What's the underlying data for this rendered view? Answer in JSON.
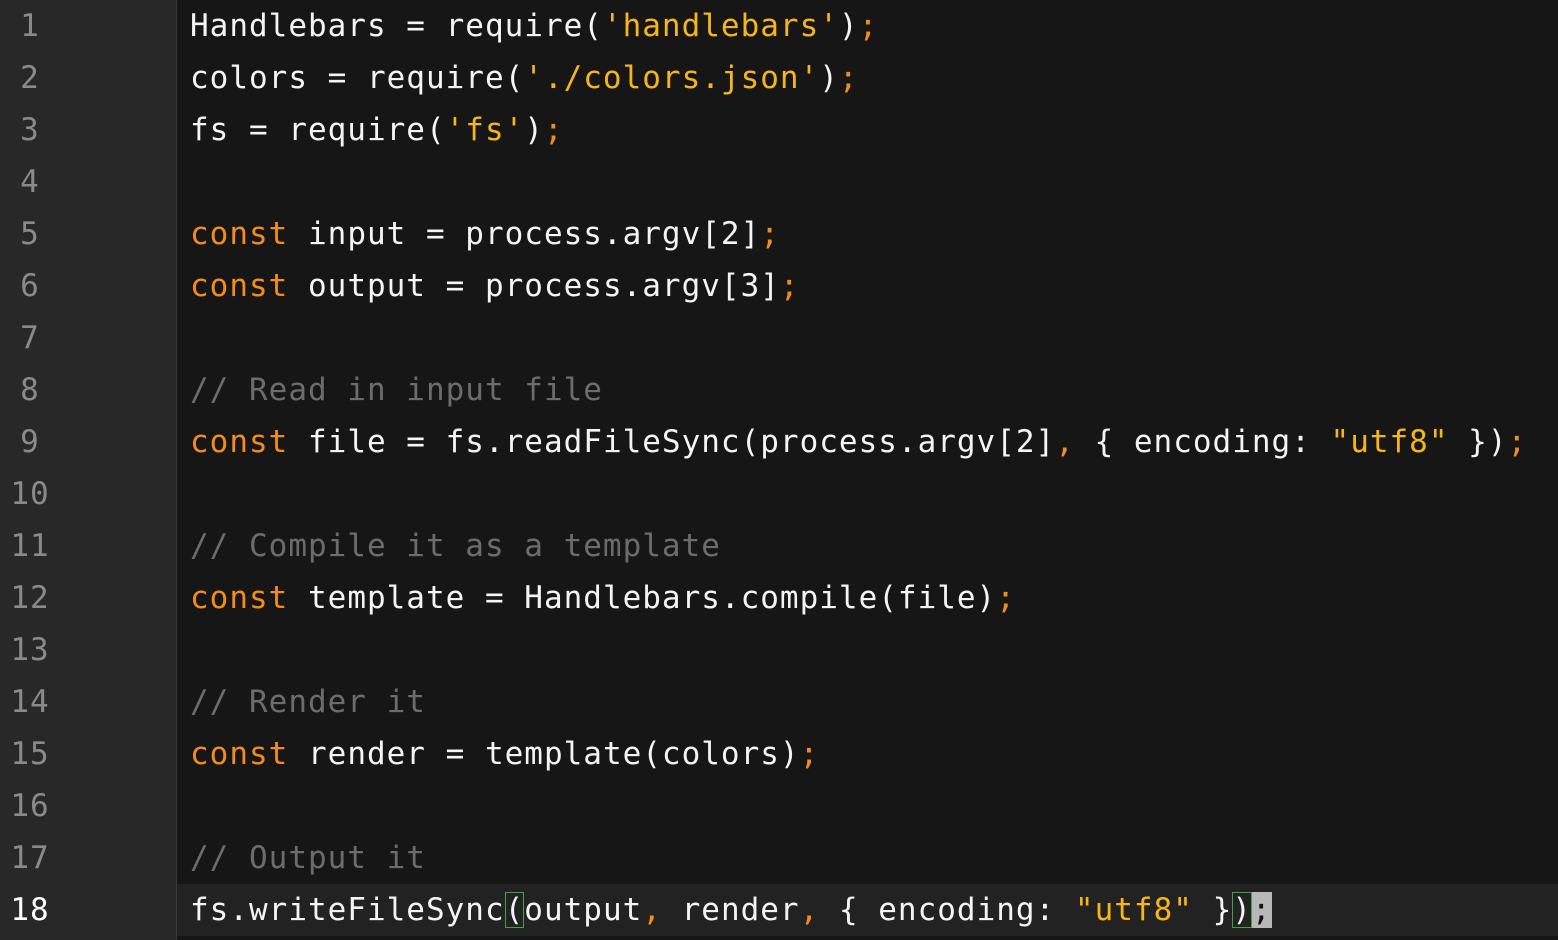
{
  "editor": {
    "colors": {
      "background": "#161616",
      "gutter": "#282828",
      "text": "#f4f4f4",
      "keyword": "#f28c1e",
      "string": "#f7b51c",
      "comment": "#6c6c6c",
      "bracket_match": "#3fa33f"
    },
    "current_line": 18,
    "lines": [
      {
        "number": "1",
        "tokens": [
          {
            "t": "t",
            "v": "Handlebars = require("
          },
          {
            "t": "s",
            "v": "'handlebars'"
          },
          {
            "t": "t",
            "v": ")"
          },
          {
            "t": "p",
            "v": ";"
          }
        ]
      },
      {
        "number": "2",
        "tokens": [
          {
            "t": "t",
            "v": "colors = require("
          },
          {
            "t": "s",
            "v": "'./colors.json'"
          },
          {
            "t": "t",
            "v": ")"
          },
          {
            "t": "p",
            "v": ";"
          }
        ]
      },
      {
        "number": "3",
        "tokens": [
          {
            "t": "t",
            "v": "fs = require("
          },
          {
            "t": "s",
            "v": "'fs'"
          },
          {
            "t": "t",
            "v": ")"
          },
          {
            "t": "p",
            "v": ";"
          }
        ]
      },
      {
        "number": "4",
        "tokens": []
      },
      {
        "number": "5",
        "tokens": [
          {
            "t": "k",
            "v": "const"
          },
          {
            "t": "t",
            "v": " input = process.argv[2]"
          },
          {
            "t": "p",
            "v": ";"
          }
        ]
      },
      {
        "number": "6",
        "tokens": [
          {
            "t": "k",
            "v": "const"
          },
          {
            "t": "t",
            "v": " output = process.argv[3]"
          },
          {
            "t": "p",
            "v": ";"
          }
        ]
      },
      {
        "number": "7",
        "tokens": []
      },
      {
        "number": "8",
        "tokens": [
          {
            "t": "c",
            "v": "// Read in input file"
          }
        ]
      },
      {
        "number": "9",
        "tokens": [
          {
            "t": "k",
            "v": "const"
          },
          {
            "t": "t",
            "v": " file = fs.readFileSync(process.argv[2]"
          },
          {
            "t": "p",
            "v": ","
          },
          {
            "t": "t",
            "v": " { encoding: "
          },
          {
            "t": "s",
            "v": "\"utf8\""
          },
          {
            "t": "t",
            "v": " })"
          },
          {
            "t": "p",
            "v": ";"
          }
        ]
      },
      {
        "number": "10",
        "tokens": []
      },
      {
        "number": "11",
        "tokens": [
          {
            "t": "c",
            "v": "// Compile it as a template"
          }
        ]
      },
      {
        "number": "12",
        "tokens": [
          {
            "t": "k",
            "v": "const"
          },
          {
            "t": "t",
            "v": " template = Handlebars.compile(file)"
          },
          {
            "t": "p",
            "v": ";"
          }
        ]
      },
      {
        "number": "13",
        "tokens": []
      },
      {
        "number": "14",
        "tokens": [
          {
            "t": "c",
            "v": "// Render it"
          }
        ]
      },
      {
        "number": "15",
        "tokens": [
          {
            "t": "k",
            "v": "const"
          },
          {
            "t": "t",
            "v": " render = template(colors)"
          },
          {
            "t": "p",
            "v": ";"
          }
        ]
      },
      {
        "number": "16",
        "tokens": []
      },
      {
        "number": "17",
        "tokens": [
          {
            "t": "c",
            "v": "// Output it"
          }
        ]
      },
      {
        "number": "18",
        "tokens": [
          {
            "t": "t",
            "v": "fs.writeFileSync"
          },
          {
            "t": "t bm",
            "v": "("
          },
          {
            "t": "t",
            "v": "output"
          },
          {
            "t": "p",
            "v": ","
          },
          {
            "t": "t",
            "v": " render"
          },
          {
            "t": "p",
            "v": ","
          },
          {
            "t": "t",
            "v": " { encoding: "
          },
          {
            "t": "s",
            "v": "\"utf8\""
          },
          {
            "t": "t",
            "v": " }"
          },
          {
            "t": "t bm",
            "v": ")"
          },
          {
            "t": "p cur",
            "v": ";"
          }
        ]
      }
    ]
  }
}
